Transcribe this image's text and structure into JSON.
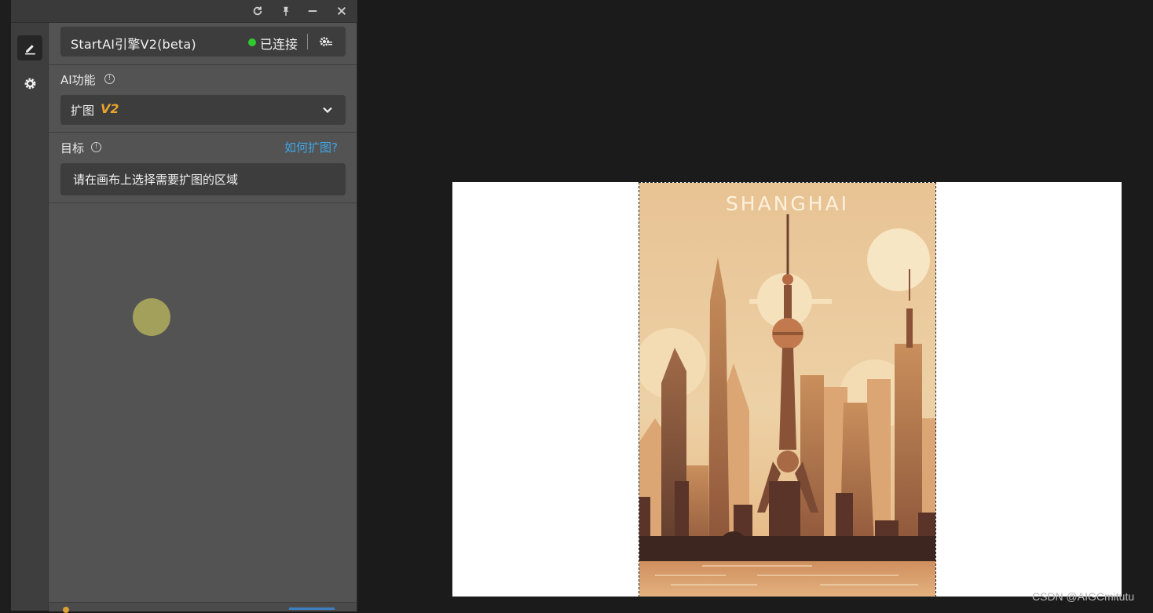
{
  "engine": {
    "name": "StartAI引擎V2(beta)",
    "status": "已连接",
    "status_color": "#2fc82f"
  },
  "ai_function": {
    "label": "AI功能",
    "info": "!",
    "selected": "扩图",
    "badge": "V2",
    "badge_color": "#e8a32e"
  },
  "target": {
    "label": "目标",
    "info": "!",
    "help_link": "如何扩图?",
    "link_color": "#3fa7e6",
    "placeholder": "请在画布上选择需要扩图的区域"
  },
  "window_controls": [
    "refresh-icon",
    "pin-icon",
    "minimize-icon",
    "close-icon"
  ],
  "sidebar": [
    "pencil-icon",
    "gear-icon"
  ],
  "poster": {
    "title": "SHANGHAI"
  },
  "watermark": "CSDN @AIGCmitutu"
}
